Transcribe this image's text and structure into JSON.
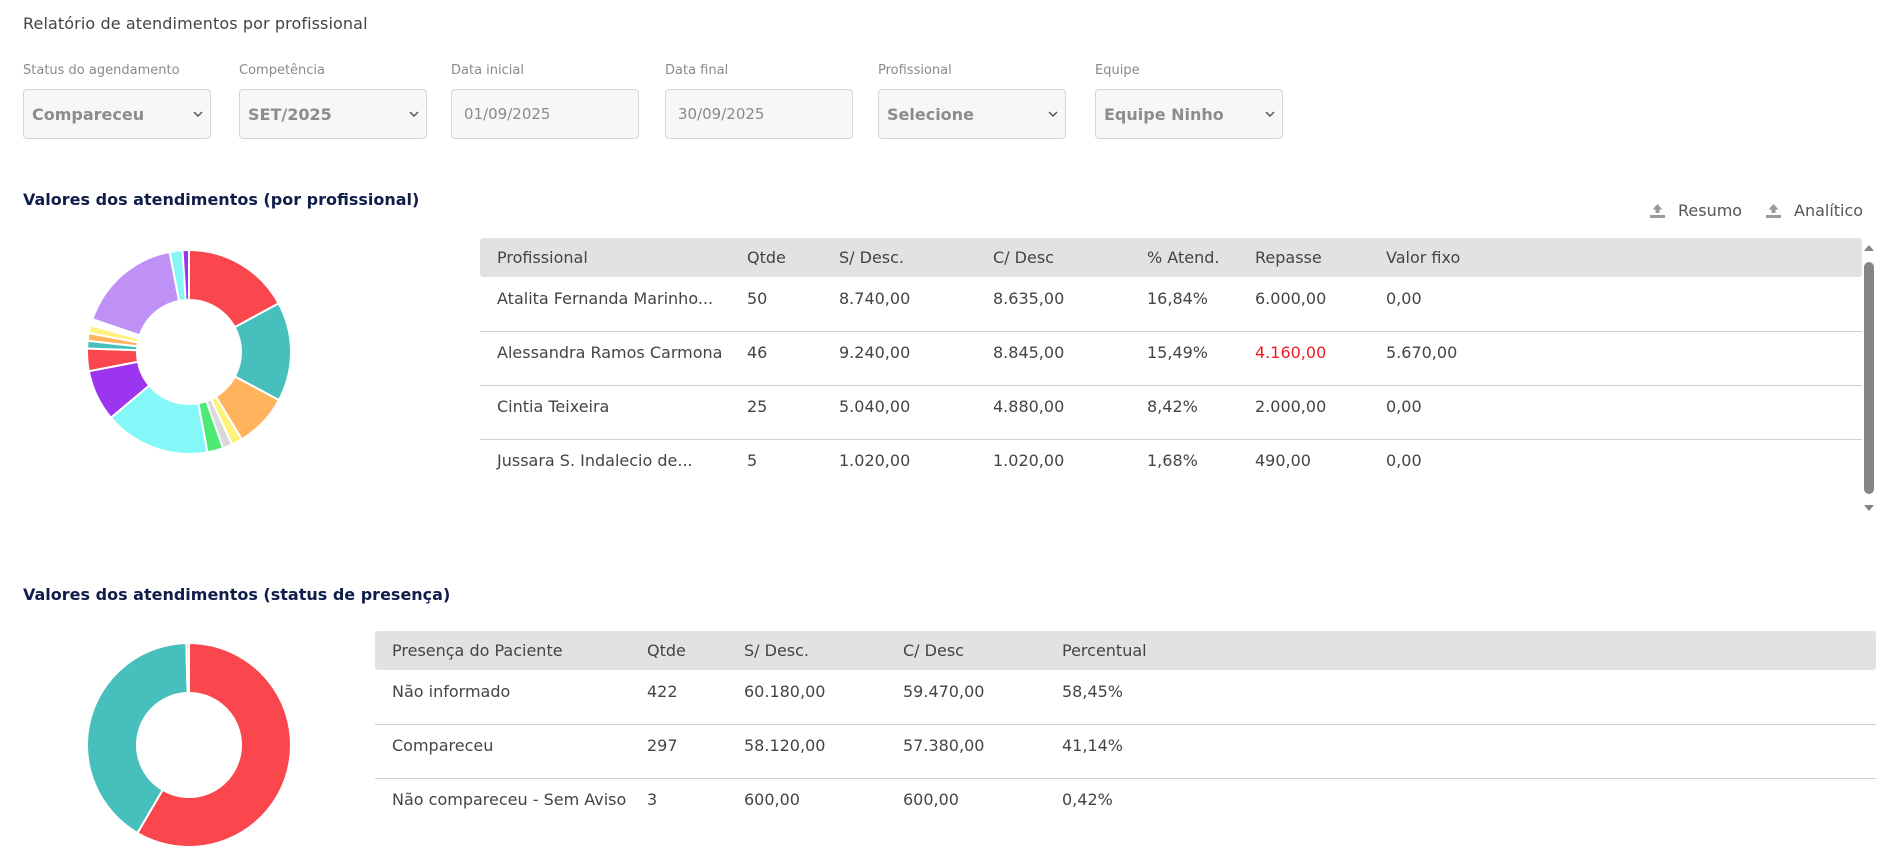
{
  "page_title": "Relatório de atendimentos por profissional",
  "filters": [
    {
      "label": "Status do agendamento",
      "value": "Compareceu",
      "kind": "select"
    },
    {
      "label": "Competência",
      "value": "SET/2025",
      "kind": "select"
    },
    {
      "label": "Data inicial",
      "value": "01/09/2025",
      "kind": "date"
    },
    {
      "label": "Data final",
      "value": "30/09/2025",
      "kind": "date"
    },
    {
      "label": "Profissional",
      "value": "Selecione",
      "kind": "select"
    },
    {
      "label": "Equipe",
      "value": "Equipe Ninho",
      "kind": "select"
    }
  ],
  "section1": {
    "title": "Valores dos atendimentos (por profissional)",
    "export_resumo": "Resumo",
    "export_analitico": "Analítico",
    "columns": [
      "Profissional",
      "Qtde",
      "S/ Desc.",
      "C/ Desc",
      "% Atend.",
      "Repasse",
      "Valor fixo"
    ],
    "rows": [
      [
        "Atalita Fernanda Marinho...",
        "50",
        "8.740,00",
        "8.635,00",
        "16,84%",
        "6.000,00",
        "0,00"
      ],
      [
        "Alessandra Ramos Carmona",
        "46",
        "9.240,00",
        "8.845,00",
        "15,49%",
        "4.160,00",
        "5.670,00"
      ],
      [
        "Cintia Teixeira",
        "25",
        "5.040,00",
        "4.880,00",
        "8,42%",
        "2.000,00",
        "0,00"
      ],
      [
        "Jussara S. Indalecio de...",
        "5",
        "1.020,00",
        "1.020,00",
        "1,68%",
        "490,00",
        "0,00"
      ]
    ],
    "repasse_highlight_color": "#ee1c24"
  },
  "section2": {
    "title": "Valores dos atendimentos (status de presença)",
    "columns": [
      "Presença do Paciente",
      "Qtde",
      "S/ Desc.",
      "C/ Desc",
      "Percentual"
    ],
    "rows": [
      [
        "Não informado",
        "422",
        "60.180,00",
        "59.470,00",
        "58,45%"
      ],
      [
        "Compareceu",
        "297",
        "58.120,00",
        "57.380,00",
        "41,14%"
      ],
      [
        "Não compareceu - Sem Aviso",
        "3",
        "600,00",
        "600,00",
        "0,42%"
      ]
    ]
  },
  "chart_data": [
    {
      "type": "pie",
      "style": "donut",
      "values": [
        16.84,
        15.49,
        8.42,
        1.68,
        1.5,
        2.5,
        16.5,
        8.0,
        3.5,
        1.2,
        1.2,
        1.2,
        1.0,
        16.5,
        2.0,
        1.0
      ],
      "colors": [
        "#f9474d",
        "#47bfbc",
        "#ffb35c",
        "#fff27a",
        "#d9d9d9",
        "#4cea74",
        "#84f8f8",
        "#9c35f0",
        "#f9474d",
        "#47bfbc",
        "#ffb35c",
        "#fff27a",
        "#ffffff",
        "#bf90f5",
        "#84f8f8",
        "#9c35f0"
      ]
    },
    {
      "type": "pie",
      "style": "donut",
      "categories": [
        "Não informado",
        "Compareceu",
        "Não compareceu - Sem Aviso"
      ],
      "values": [
        58.45,
        41.14,
        0.42
      ],
      "colors": [
        "#f9474d",
        "#47bfbc",
        "#84f8f8"
      ]
    }
  ]
}
